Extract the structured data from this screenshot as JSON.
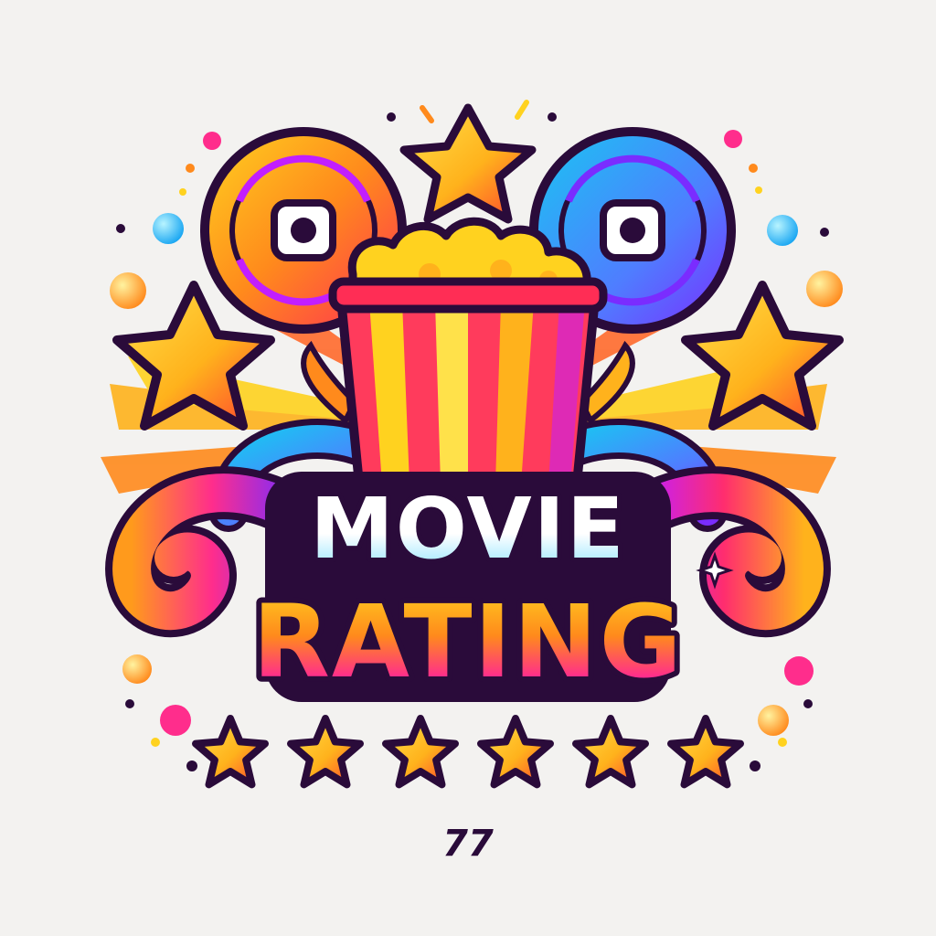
{
  "logo": {
    "title_line1": "MOVIE",
    "title_line2": "RATING",
    "caption": "77",
    "rating_stars": 6
  },
  "icons": {
    "left_reel": "film-reel-icon",
    "right_reel": "film-reel-icon",
    "popcorn": "popcorn-icon",
    "top_star": "star-icon",
    "side_stars": "star-icon",
    "rating_row": "star-icon"
  },
  "colors": {
    "background": "#f3f2f0",
    "outline": "#2a0b3a",
    "yellow": "#ffd21f",
    "orange": "#ff8a1c",
    "red": "#ff2d55",
    "magenta": "#e81eb4",
    "purple": "#7a2cff",
    "cyan": "#19c6f2"
  }
}
